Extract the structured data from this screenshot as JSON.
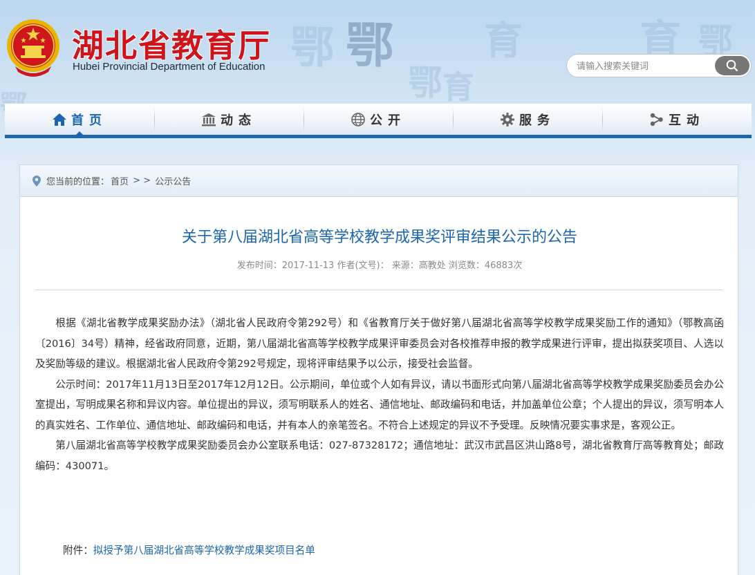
{
  "header": {
    "title": "湖北省教育厅",
    "subtitle": "Hubei Provincial Department of Education",
    "search_placeholder": "请输入搜索关键词"
  },
  "background_glyphs": [
    "鄂",
    "鄂",
    "育",
    "鄂",
    "育",
    "鄂",
    "育",
    "鄂"
  ],
  "nav": {
    "items": [
      {
        "label": "首页",
        "icon": "home-icon",
        "active": true
      },
      {
        "label": "动态",
        "icon": "building-icon",
        "active": false
      },
      {
        "label": "公开",
        "icon": "globe-icon",
        "active": false
      },
      {
        "label": "服务",
        "icon": "gear-icon",
        "active": false
      },
      {
        "label": "互动",
        "icon": "share-icon",
        "active": false
      }
    ]
  },
  "breadcrumb": {
    "prefix": "您当前的位置：",
    "home": "首页",
    "separator": " > > ",
    "current": "公示公告"
  },
  "article": {
    "title": "关于第八届湖北省高等学校教学成果奖评审结果公示的公告",
    "meta": "发布时间：2017-11-13 作者(文号)： 来源：高教处 浏览数：46883次",
    "paragraphs": [
      "根据《湖北省教学成果奖励办法》（湖北省人民政府令第292号）和《省教育厅关于做好第八届湖北省高等学校教学成果奖励工作的通知》（鄂教高函〔2016〕34号）精神，经省政府同意，近期，第八届湖北省高等学校教学成果评审委员会对各校推荐申报的教学成果进行评审，提出拟获奖项目、人选以及奖励等级的建议。根据湖北省人民政府令第292号规定，现将评审结果予以公示，接受社会监督。",
      "公示时间：2017年11月13日至2017年12月12日。公示期间，单位或个人如有异议，请以书面形式向第八届湖北省高等学校教学成果奖励委员会办公室提出，写明成果名称和异议内容。单位提出的异议，须写明联系人的姓名、通信地址、邮政编码和电话，并加盖单位公章；个人提出的异议，须写明本人的真实姓名、工作单位、通信地址、邮政编码和电话，并有本人的亲笔签名。不符合上述规定的异议不予受理。反映情况要实事求是，客观公正。",
      "第八届湖北省高等学校教学成果奖励委员会办公室联系电话：027-87328172；通信地址：武汉市武昌区洪山路8号，湖北省教育厅高等教育处；邮政编码：430071。"
    ],
    "attachment_label": "附件：",
    "attachment_link": "拟授予第八届湖北省高等学校教学成果奖项目名单"
  },
  "colors": {
    "brand_red": "#d0141c",
    "nav_blue": "#1b65b1",
    "emblem_gold": "#e8b400"
  }
}
